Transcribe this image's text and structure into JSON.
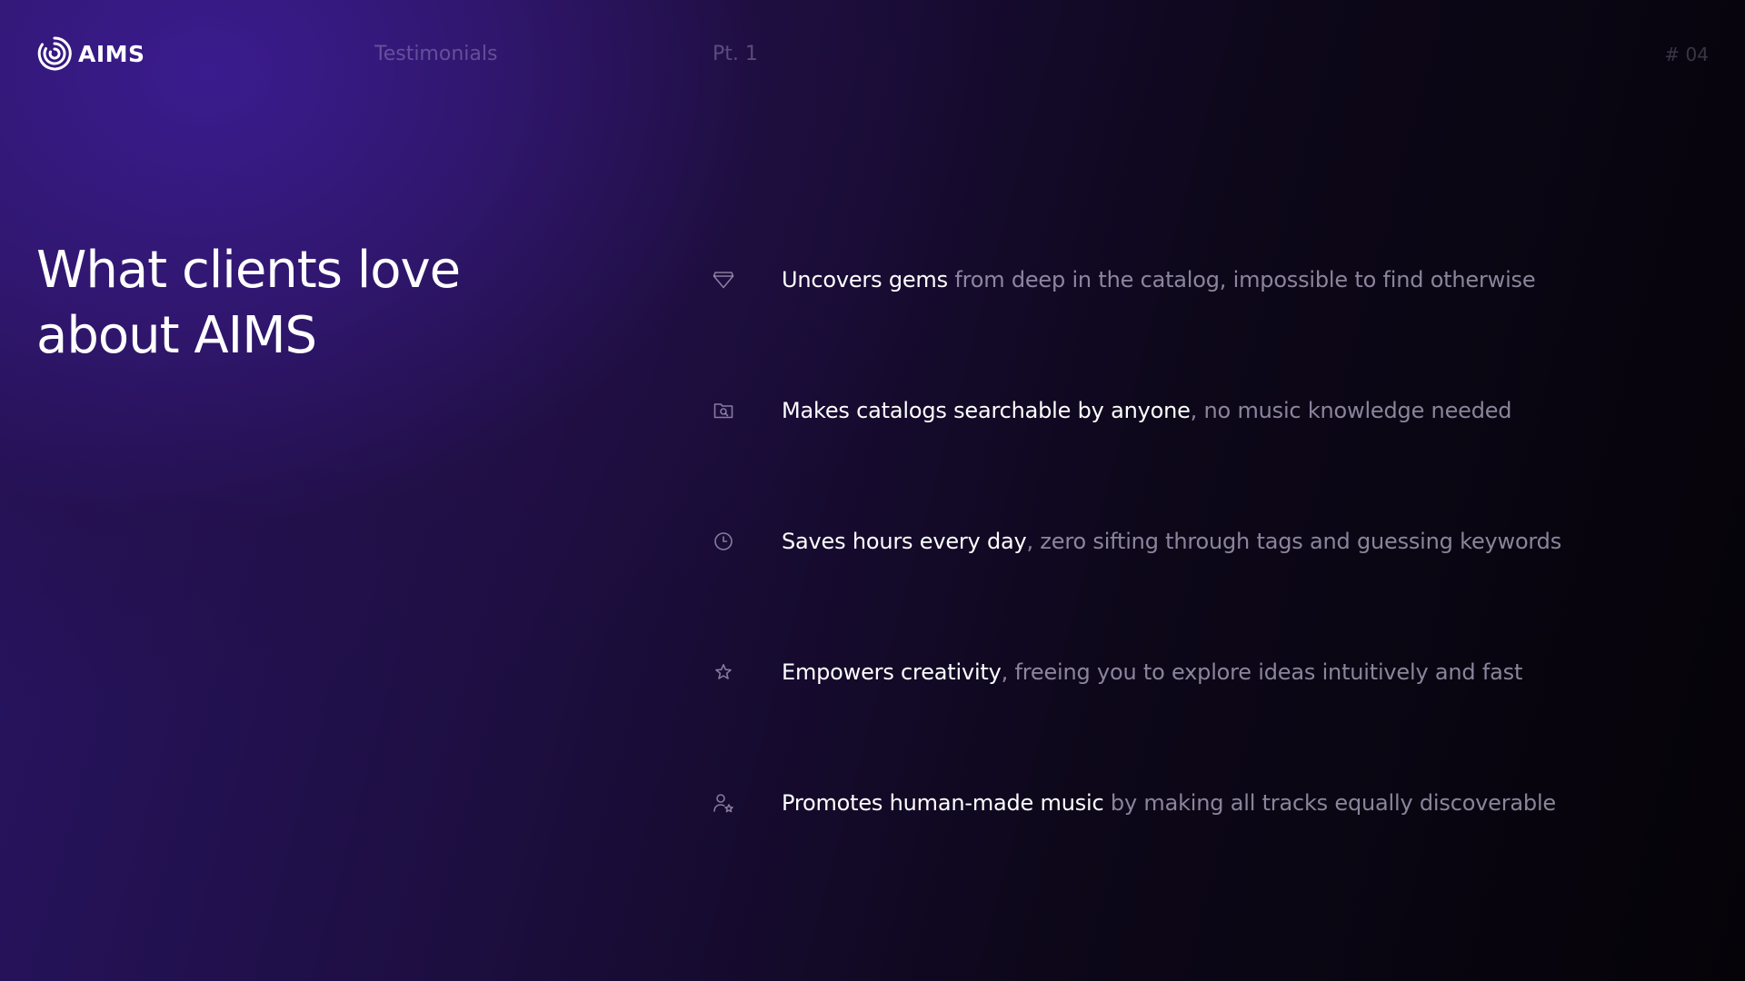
{
  "brand": {
    "logo_icon": "aims-swirl-logo",
    "name": "AIMS"
  },
  "header": {
    "section": "Testimonials",
    "part": "Pt. 1",
    "page": "# 04"
  },
  "headline": {
    "line1": "What clients love",
    "line2": "about AIMS"
  },
  "features": [
    {
      "icon": "heart-icon",
      "strong": "Uncovers gems",
      "rest": " from deep in the catalog, impossible to find otherwise"
    },
    {
      "icon": "folder-search-icon",
      "strong": "Makes catalogs searchable by anyone",
      "rest": ", no music knowledge needed"
    },
    {
      "icon": "clock-icon",
      "strong": "Saves hours every day",
      "rest": ", zero sifting through tags and guessing keywords"
    },
    {
      "icon": "star-icon",
      "strong": "Empowers creativity",
      "rest": ", freeing you to explore ideas intuitively and fast"
    },
    {
      "icon": "user-star-icon",
      "strong": "Promotes human-made music",
      "rest": " by making all tracks equally discoverable"
    }
  ],
  "colors": {
    "accent_purple": "#3c1c91",
    "background_dark": "#050308",
    "text_primary": "#ffffff",
    "text_secondary": "#beb6d0"
  }
}
